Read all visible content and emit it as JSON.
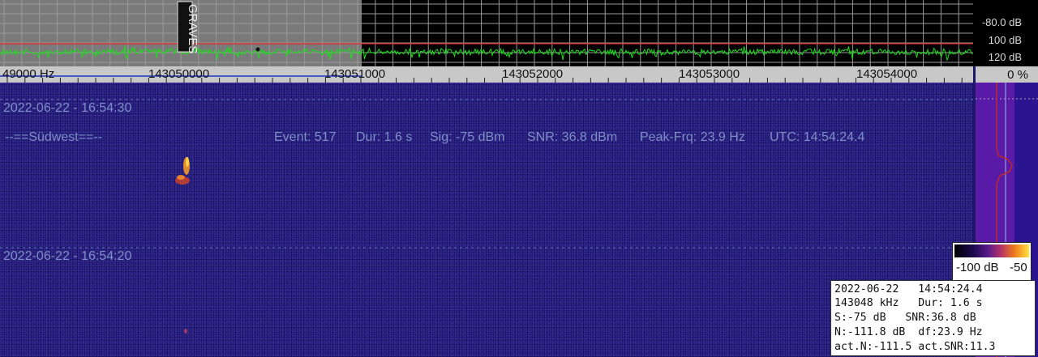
{
  "spectrum": {
    "db_labels": [
      "-80.0 dB",
      "100 dB",
      "120 dB"
    ],
    "marker_label": "GRAVES",
    "colors": {
      "trace": "#19e019",
      "threshold": "#e02020",
      "grid": "#9a9a9a",
      "highlight": "#7a7a7a"
    }
  },
  "freq_axis": {
    "labels": [
      "49000 Hz",
      "143050000",
      "143051000",
      "143052000",
      "143053000",
      "143054000"
    ],
    "percent": "0 %"
  },
  "waterfall": {
    "timestamp_1": "2022-06-22 - 16:54:30",
    "timestamp_2": "2022-06-22 - 16:54:20",
    "station": "--==Südwest==--",
    "event": "Event: 517",
    "duration": "Dur: 1.6 s",
    "signal": "Sig: -75 dBm",
    "snr": "SNR: 36.8 dBm",
    "peak_freq": "Peak-Frq: 23.9 Hz",
    "utc": "UTC: 14:54:24.4"
  },
  "color_scale": {
    "low": "-100 dB",
    "high": "-50"
  },
  "info_panel": {
    "line1": "2022-06-22   14:54:24.4",
    "line2": "143048 kHz   Dur: 1.6 s",
    "line3": "S:-75 dB   SNR:36.8 dB",
    "line4": "N:-111.8 dB  df:23.9 Hz",
    "line5": "act.N:-111.5 act.SNR:11.3"
  }
}
